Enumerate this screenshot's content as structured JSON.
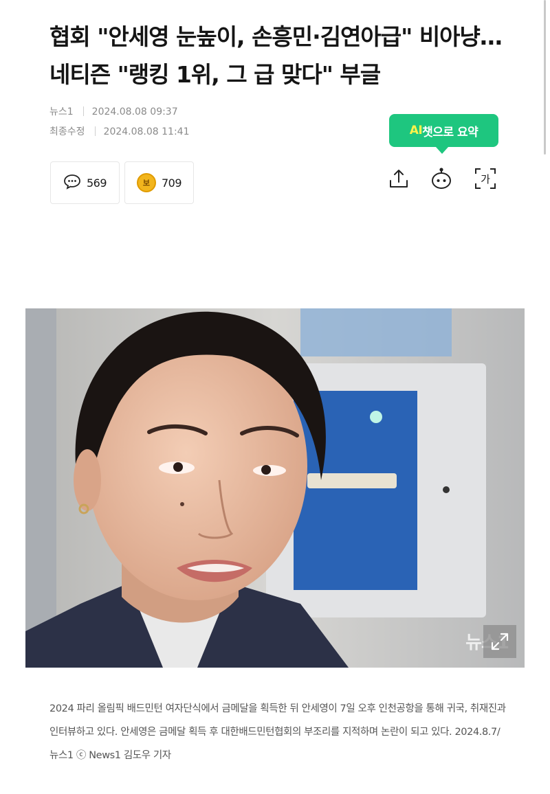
{
  "article": {
    "headline": "협회 \"안세영 눈높이, 손흥민·김연아급\" 비아냥…네티즌 \"랭킹 1위, 그 급 맞다\" 부글",
    "source": "뉴스1",
    "published": "2024.08.08 09:37",
    "modified_label": "최종수정",
    "modified": "2024.08.08 11:41"
  },
  "actions": {
    "ai_prefix": "AI",
    "ai_suffix": "챗으로 요약",
    "comment_count": "569",
    "coin_label": "보",
    "coin_count": "709"
  },
  "tool_icons": [
    "share-icon",
    "ai-bot-icon",
    "font-size-icon"
  ],
  "hero": {
    "watermark": "뉴스1"
  },
  "caption": {
    "text": "2024 파리 올림픽 배드민턴 여자단식에서 금메달을 획득한 뒤 안세영이 7일 오후 인천공항을 통해 귀국, 취재진과 인터뷰하고 있다. 안세영은 금메달 획득 후 대한배드민턴협회의 부조리를 지적하며 논란이 되고 있다. 2024.8.7/뉴스1 ⓒ News1 김도우 기자"
  },
  "colors": {
    "ai_button": "#1ec67f",
    "ai_accent": "#fff34a",
    "coin": "#f2b51d"
  }
}
